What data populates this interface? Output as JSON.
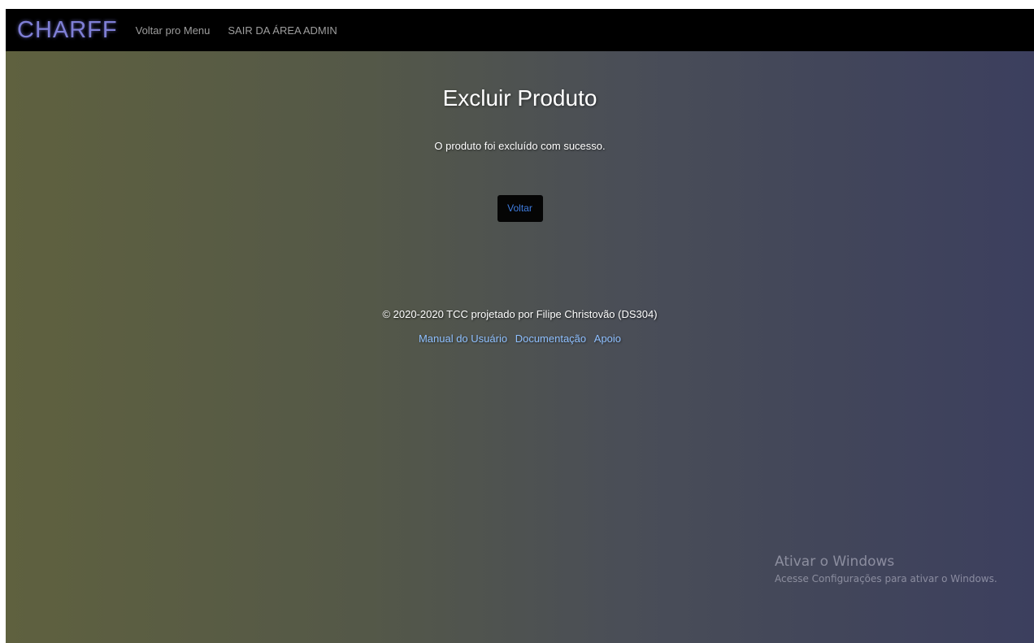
{
  "navbar": {
    "brand": "CHARFF",
    "links": [
      {
        "label": "Voltar pro Menu"
      },
      {
        "label": "SAIR DA ÁREA ADMIN"
      }
    ]
  },
  "main": {
    "title": "Excluir Produto",
    "message": "O produto foi excluído com sucesso.",
    "back_button": "Voltar"
  },
  "footer": {
    "copyright": "© 2020-2020 TCC projetado por Filipe Christovão (DS304)",
    "links": [
      {
        "label": "Manual do Usuário"
      },
      {
        "label": "Documentação"
      },
      {
        "label": "Apoio"
      }
    ]
  },
  "watermark": {
    "title": "Ativar o Windows",
    "subtitle": "Acesse Configurações para ativar o Windows."
  },
  "colors": {
    "navbar_bg": "#000000",
    "brand": "#7f7fd6",
    "link": "#8fc0ff",
    "button_text": "#3f7de0"
  }
}
